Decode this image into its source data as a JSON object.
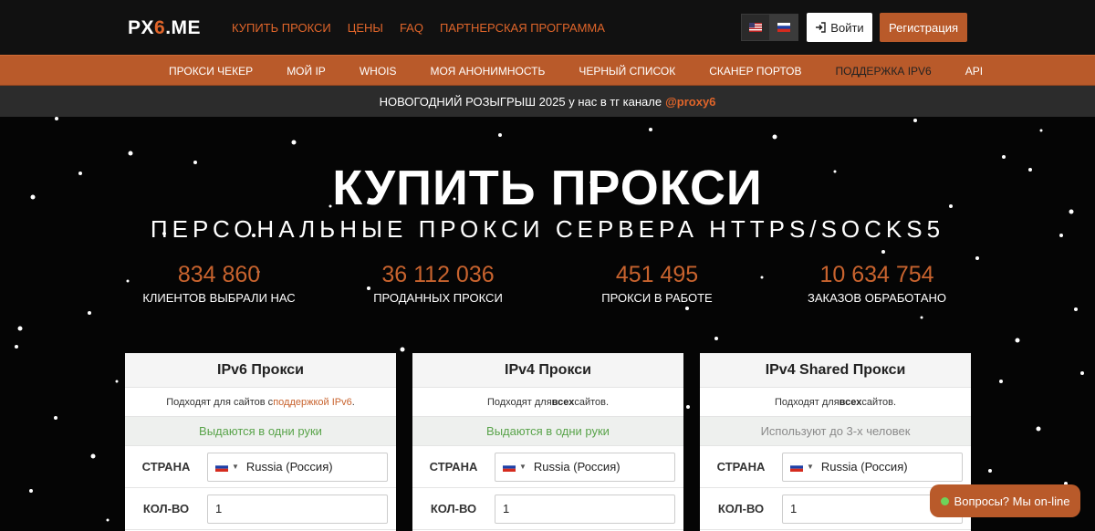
{
  "logo": {
    "prefix": "PX",
    "accent": "6",
    "suffix": ".ME"
  },
  "top_nav": [
    "КУПИТЬ ПРОКСИ",
    "ЦЕНЫ",
    "FAQ",
    "ПАРТНЕРСКАЯ ПРОГРАММА"
  ],
  "language": {
    "options": [
      "en",
      "ru"
    ],
    "selected": "ru"
  },
  "auth": {
    "login_label": "Войти",
    "register_label": "Регистрация"
  },
  "sub_nav": [
    {
      "label": "ПРОКСИ ЧЕКЕР",
      "active": false
    },
    {
      "label": "МОЙ IP",
      "active": false
    },
    {
      "label": "WHOIS",
      "active": false
    },
    {
      "label": "МОЯ АНОНИМНОСТЬ",
      "active": false
    },
    {
      "label": "ЧЕРНЫЙ СПИСОК",
      "active": false
    },
    {
      "label": "СКАНЕР ПОРТОВ",
      "active": false
    },
    {
      "label": "ПОДДЕРЖКА IPV6",
      "active": true
    },
    {
      "label": "API",
      "active": false
    }
  ],
  "announcement": {
    "text": "НОВОГОДНИЙ РОЗЫГРЫШ 2025 у нас в тг канале",
    "link": "@proxy6"
  },
  "hero": {
    "title": "КУПИТЬ ПРОКСИ",
    "subtitle": "ПЕРСОНАЛЬНЫЕ ПРОКСИ СЕРВЕРА HTTPS/SOCKS5"
  },
  "stats": [
    {
      "value": "834 860",
      "label": "КЛИЕНТОВ ВЫБРАЛИ НАС"
    },
    {
      "value": "36 112 036",
      "label": "ПРОДАННЫХ ПРОКСИ"
    },
    {
      "value": "451 495",
      "label": "ПРОКСИ В РАБОТЕ"
    },
    {
      "value": "10 634 754",
      "label": "ЗАКАЗОВ ОБРАБОТАНО"
    }
  ],
  "cards": [
    {
      "title": "IPv6 Прокси",
      "desc_pre": "Подходят для сайтов с ",
      "desc_em": "поддержкой IPv6",
      "desc_post": ".",
      "note": "Выдаются в одни руки",
      "country_label": "СТРАНА",
      "country_value": "Russia (Россия)",
      "qty_label": "КОЛ-ВО",
      "qty_value": "1"
    },
    {
      "title": "IPv4 Прокси",
      "desc_pre": "Подходят для ",
      "desc_em": "всех",
      "desc_post": " сайтов.",
      "note": "Выдаются в одни руки",
      "country_label": "СТРАНА",
      "country_value": "Russia (Россия)",
      "qty_label": "КОЛ-ВО",
      "qty_value": "1"
    },
    {
      "title": "IPv4 Shared Прокси",
      "desc_pre": "Подходят для ",
      "desc_em": "всех",
      "desc_post": " сайтов.",
      "note": "Используют до 3-х человек",
      "country_label": "СТРАНА",
      "country_value": "Russia (Россия)",
      "qty_label": "КОЛ-ВО",
      "qty_value": "1"
    }
  ],
  "chat": {
    "label": "Вопросы? Мы on-line",
    "status_color": "#6ed35a"
  },
  "colors": {
    "accent": "#e0652a",
    "nav_orange": "#b95a2a",
    "note_green": "#5aa44b"
  }
}
